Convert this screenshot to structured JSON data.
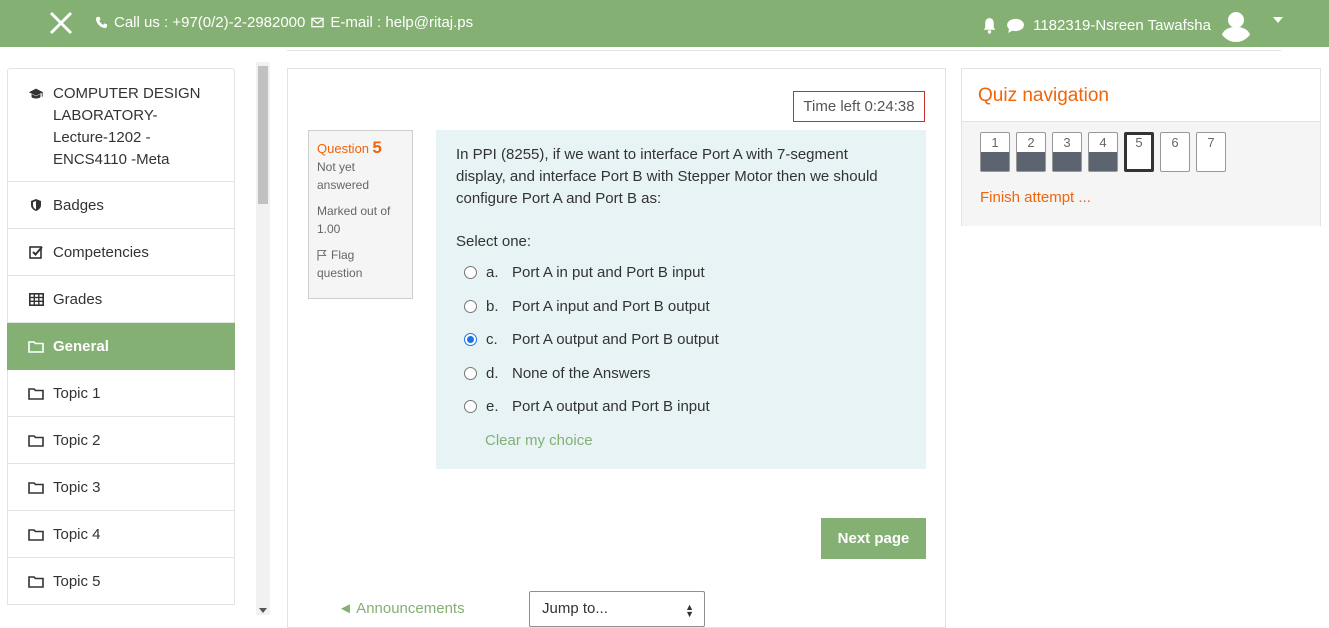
{
  "topbar": {
    "phone": "Call us : +97(0/2)-2-2982000",
    "email": "E-mail : help@ritaj.ps",
    "username": "1182319-Nsreen Tawafsha"
  },
  "sidebar": {
    "course_name": "COMPUTER DESIGN LABORATORY- Lecture-1202 - ENCS4110 -Meta",
    "course_lines": [
      "COMPUTER DESIGN",
      "LABORATORY-",
      "Lecture-1202 -",
      "ENCS4110 -Meta"
    ],
    "items": [
      {
        "label": "Badges",
        "icon": "shield-icon"
      },
      {
        "label": "Competencies",
        "icon": "checkbox-icon"
      },
      {
        "label": "Grades",
        "icon": "table-icon"
      },
      {
        "label": "General",
        "icon": "folder-icon",
        "active": true
      },
      {
        "label": "Topic 1",
        "icon": "folder-icon"
      },
      {
        "label": "Topic 2",
        "icon": "folder-icon"
      },
      {
        "label": "Topic 3",
        "icon": "folder-icon"
      },
      {
        "label": "Topic 4",
        "icon": "folder-icon"
      },
      {
        "label": "Topic 5",
        "icon": "folder-icon"
      }
    ]
  },
  "quiz": {
    "time_left": "Time left 0:24:38",
    "question_label": "Question",
    "question_number": "5",
    "status_1": "Not yet",
    "status_2": "answered",
    "marked_1": "Marked out of",
    "marked_2": "1.00",
    "flag_1": "Flag",
    "flag_2": "question",
    "question_text": "In PPI (8255), if we want to interface Port A with 7-segment display, and interface Port B with Stepper Motor then we should configure Port A and Port B as:",
    "select_one": "Select one:",
    "answers": [
      {
        "letter": "a.",
        "text": "Port A in put and Port B input",
        "checked": false
      },
      {
        "letter": "b.",
        "text": "Port A input and Port B output",
        "checked": false
      },
      {
        "letter": "c.",
        "text": "Port A output and Port B output",
        "checked": true
      },
      {
        "letter": "d.",
        "text": "None of the Answers",
        "checked": false
      },
      {
        "letter": "e.",
        "text": "Port A output and Port B input",
        "checked": false
      }
    ],
    "clear_choice": "Clear my choice",
    "next_page": "Next page",
    "prev_link": "◄ Announcements",
    "jump_to": "Jump to..."
  },
  "quiz_nav": {
    "title": "Quiz navigation",
    "questions": [
      {
        "num": "1",
        "answered": true,
        "current": false
      },
      {
        "num": "2",
        "answered": true,
        "current": false
      },
      {
        "num": "3",
        "answered": true,
        "current": false
      },
      {
        "num": "4",
        "answered": true,
        "current": false
      },
      {
        "num": "5",
        "answered": false,
        "current": true
      },
      {
        "num": "6",
        "answered": false,
        "current": false
      },
      {
        "num": "7",
        "answered": false,
        "current": false
      }
    ],
    "finish": "Finish attempt ..."
  },
  "colors": {
    "brand_green": "#84b073",
    "accent_orange": "#f0640a",
    "timer_border": "#c9302c",
    "question_bg": "#e7f3f5",
    "answered_fill": "#5c6470"
  }
}
